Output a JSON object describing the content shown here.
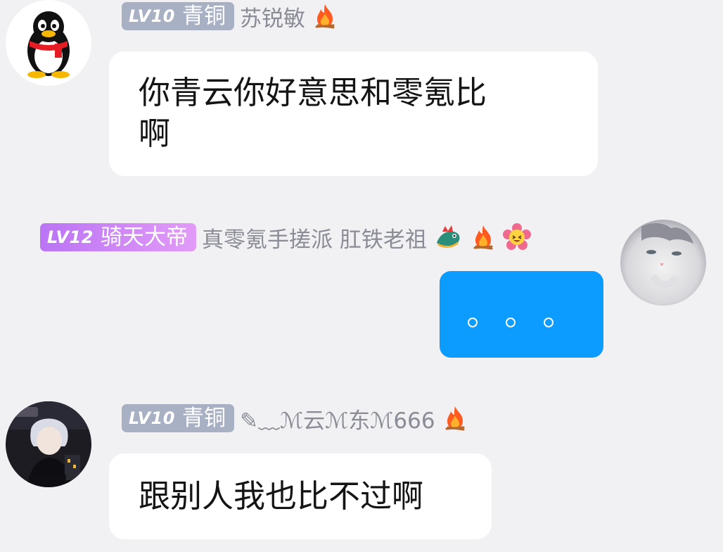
{
  "messages": [
    {
      "badge": {
        "level": "LV10",
        "title": "青铜"
      },
      "name": "苏锐敏",
      "icons": [
        "fire-icon"
      ],
      "text_line1": "你青云你好意思和零氪比",
      "text_line2": "啊"
    },
    {
      "badge": {
        "level": "LV12",
        "title": "骑天大帝"
      },
      "name": "真零氪手搓派  肛铁老祖",
      "icons": [
        "dragon-icon",
        "fire-icon",
        "flower-emoji-icon"
      ],
      "text": "。。。"
    },
    {
      "badge": {
        "level": "LV10",
        "title": "青铜"
      },
      "name": "✎﹏ℳ云ℳ东ℳ666",
      "icons": [
        "fire-icon"
      ],
      "text": "跟别人我也比不过啊"
    }
  ],
  "colors": {
    "background": "#f1f1f3",
    "own_bubble": "#0c9bff",
    "bronze_badge": "#a8b0c4",
    "purple_badge": "#bb74f4"
  }
}
